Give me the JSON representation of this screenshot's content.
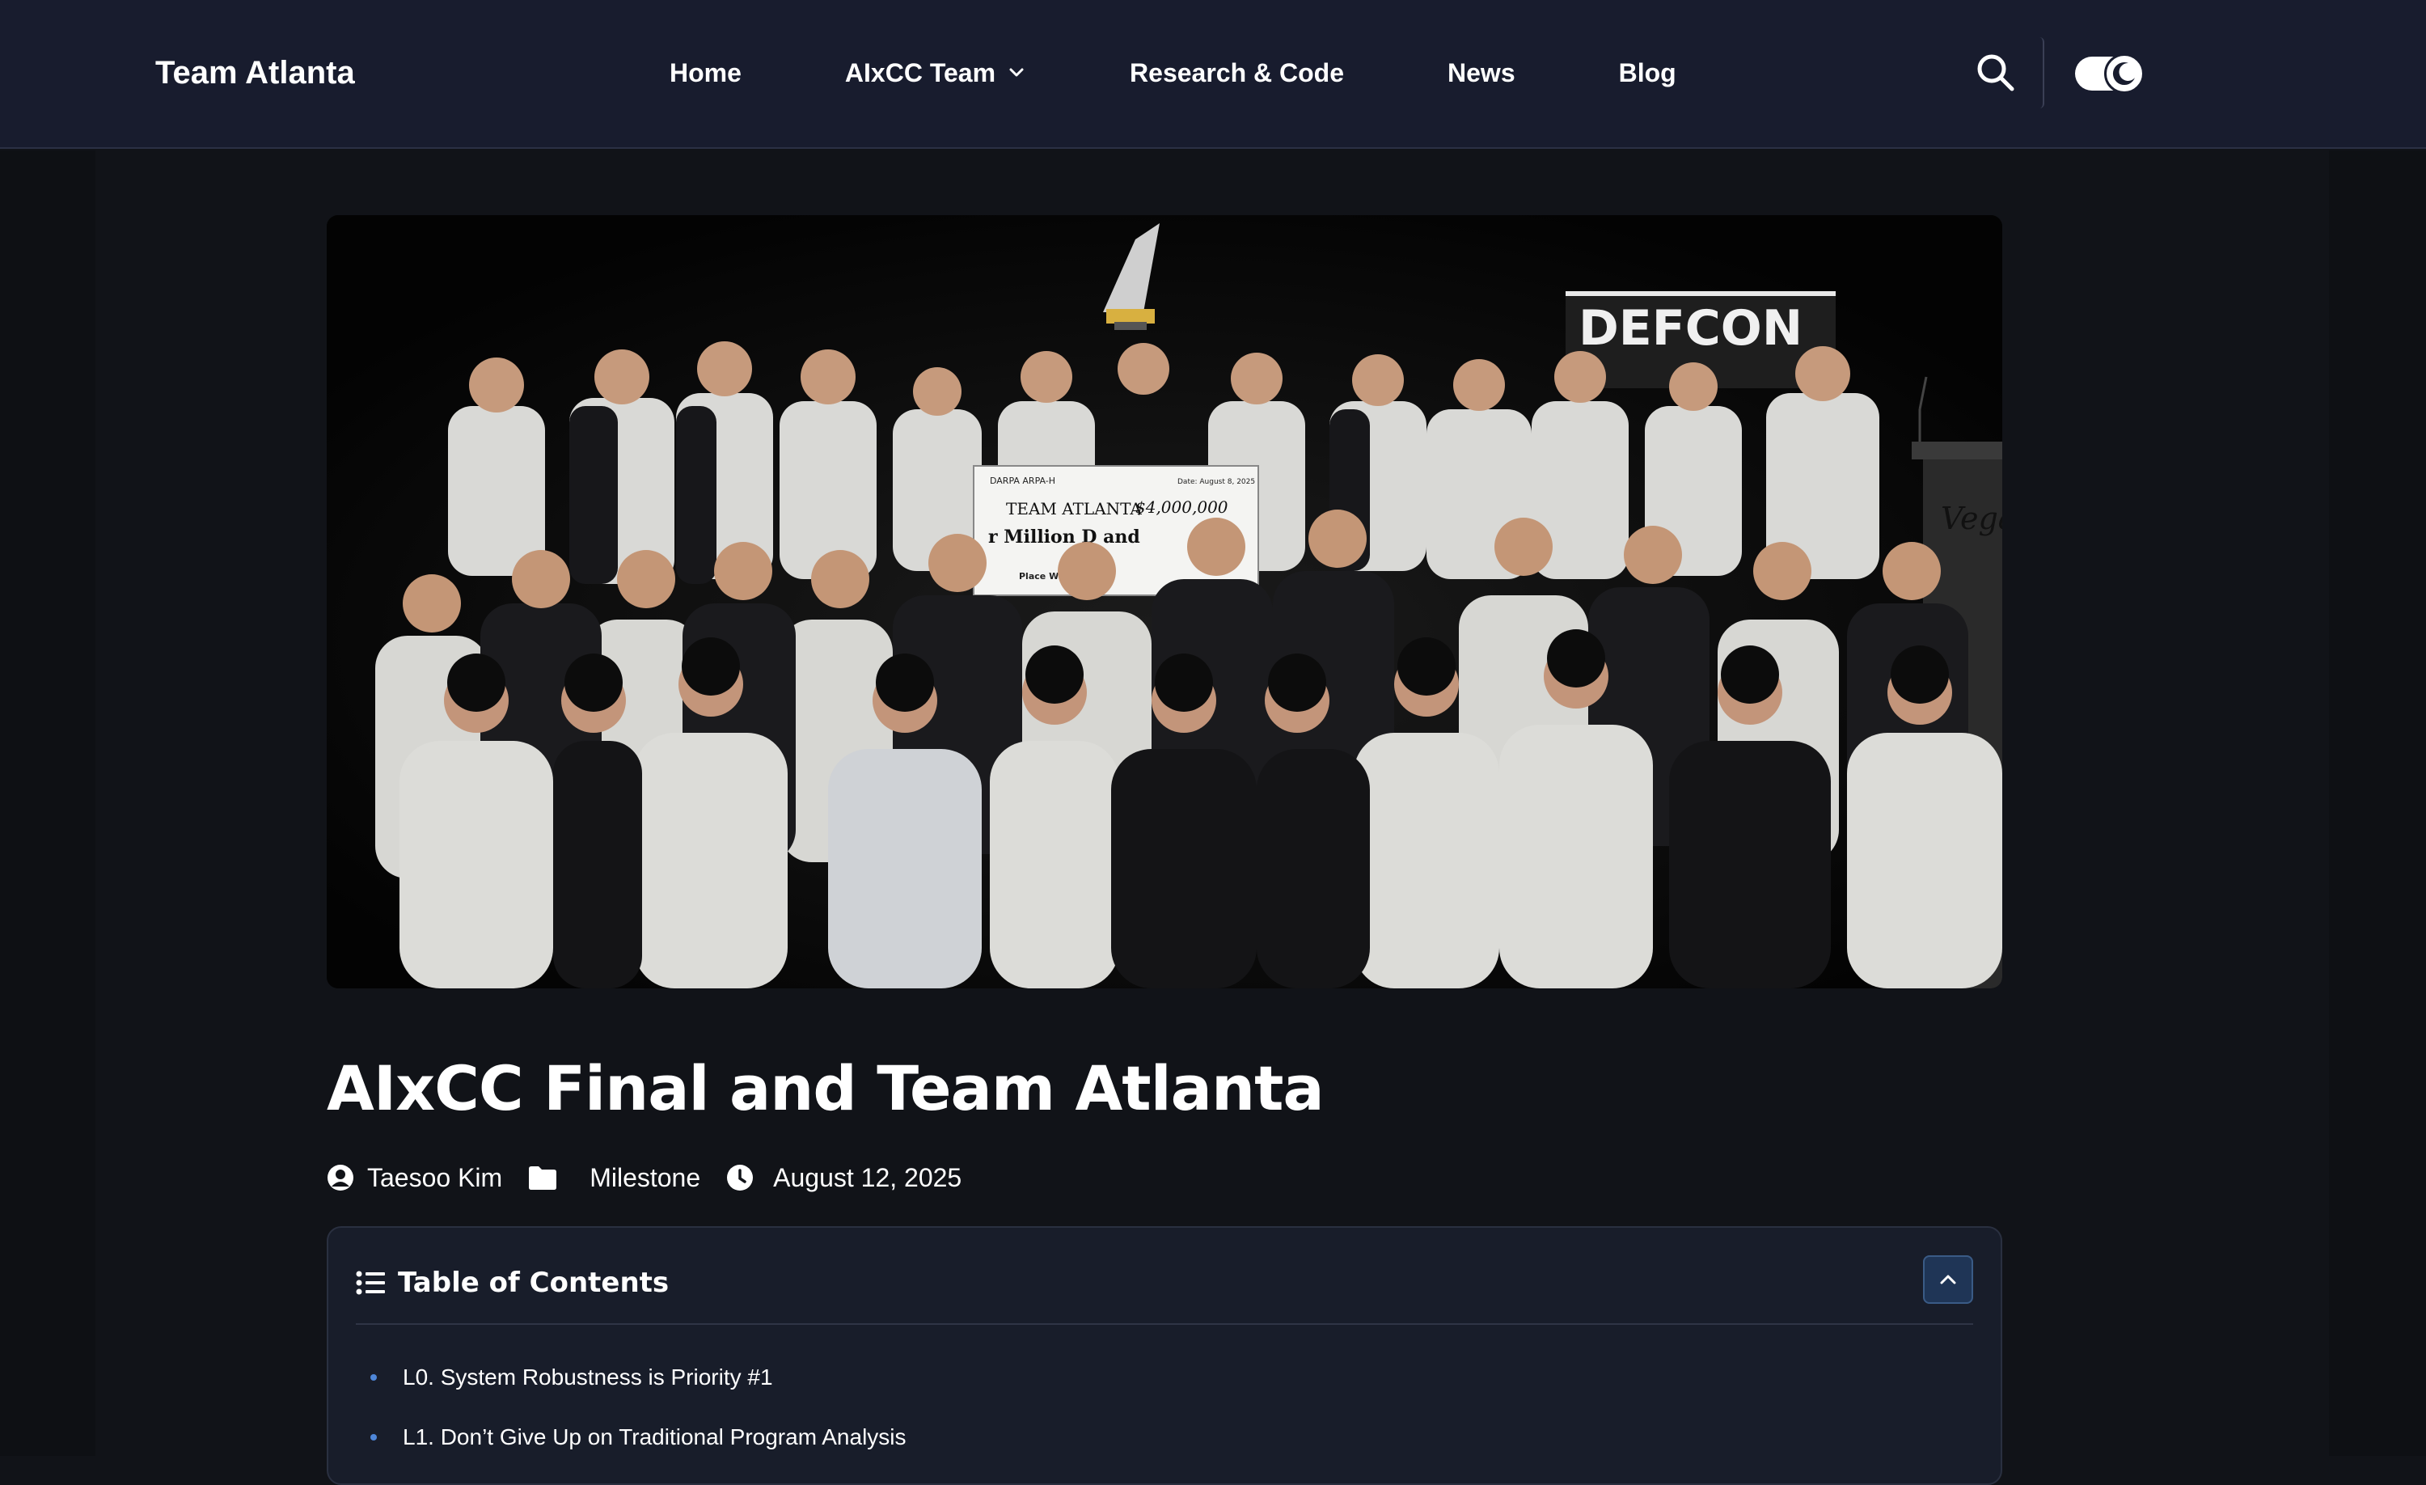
{
  "header": {
    "brand": "Team Atlanta",
    "nav": [
      {
        "label": "Home",
        "icon": null
      },
      {
        "label": "AIxCC Team",
        "icon": "chevron-down-icon"
      },
      {
        "label": "Research & Code",
        "icon": null
      },
      {
        "label": "News",
        "icon": null
      },
      {
        "label": "Blog",
        "icon": null
      }
    ],
    "search_icon": "search-icon",
    "theme_toggle": {
      "icon": "moon-icon",
      "state": "dark"
    }
  },
  "hero": {
    "banner_text": "DEFCON",
    "check": {
      "logos": "DARPA ARPA-H",
      "date": "Date: August 8, 2025",
      "payee": "TEAM ATLANTA",
      "amount": "$4,000,000",
      "amount_words": "r Million D    and",
      "fraction": "%",
      "memo": "Place Winner"
    },
    "podium_text": "Vega"
  },
  "post": {
    "title": "AIxCC Final and Team Atlanta",
    "meta": {
      "author": "Taesoo Kim",
      "category": "Milestone",
      "date": "August 12, 2025"
    }
  },
  "toc": {
    "title": "Table of Contents",
    "items": [
      "L0. System Robustness is Priority #1",
      "L1. Don’t Give Up on Traditional Program Analysis"
    ]
  },
  "colors": {
    "header_bg": "#181c2e",
    "page_bg": "#111318",
    "toc_bg": "#181d2a",
    "accent": "#4e86d8",
    "collapse_btn": "#1f3556"
  }
}
